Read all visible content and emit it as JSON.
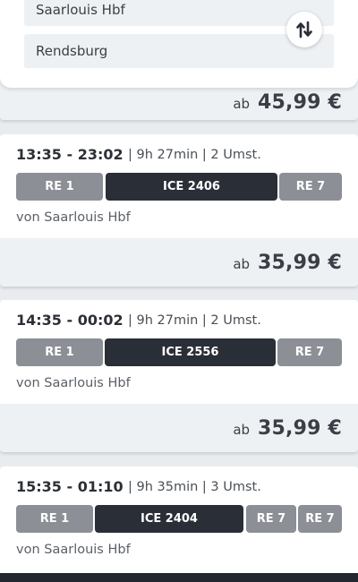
{
  "search": {
    "from_value": "Saarlouis Hbf",
    "to_value": "Rendsburg",
    "swap_icon": "swap-vertical-arrows-icon"
  },
  "prices": {
    "top": {
      "prefix": "ab",
      "amount": "45,99 €"
    },
    "after_card_1": {
      "prefix": "ab",
      "amount": "35,99 €"
    },
    "after_card_2": {
      "prefix": "ab",
      "amount": "35,99 €"
    }
  },
  "connections": [
    {
      "times": "13:35 - 23:02",
      "meta": "| 9h 27min | 2 Umst.",
      "legs": [
        "RE 1",
        "ICE 2406",
        "RE 7"
      ],
      "from": "von Saarlouis Hbf"
    },
    {
      "times": "14:35 - 00:02",
      "meta": "| 9h 27min | 2 Umst.",
      "legs": [
        "RE 1",
        "ICE 2556",
        "RE 7"
      ],
      "from": "von Saarlouis Hbf"
    },
    {
      "times": "15:35 - 01:10",
      "meta": "| 9h 35min | 3 Umst.",
      "legs": [
        "RE 1",
        "ICE 2404",
        "RE 7",
        "RE 7"
      ],
      "from": "von Saarlouis Hbf"
    }
  ],
  "colors": {
    "regional_train": "#8c8f95",
    "ice_train": "#2a2e37",
    "price_background": "#eef1f4"
  }
}
